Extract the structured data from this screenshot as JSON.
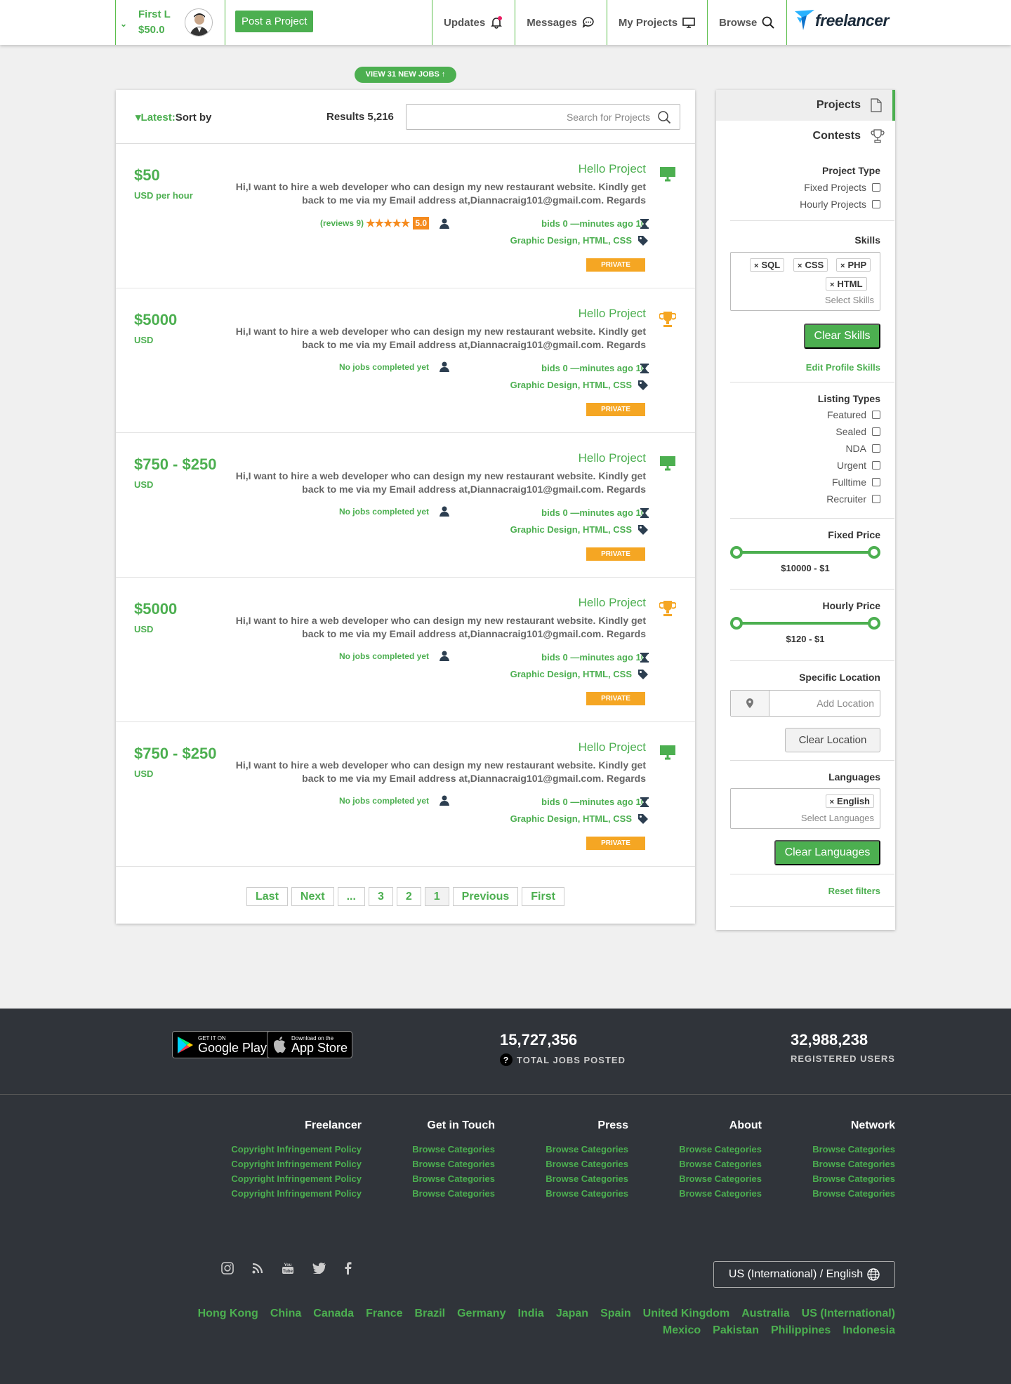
{
  "header": {
    "user_name": "First L",
    "balance": "$50.0",
    "post_button": "Post a Project",
    "nav": [
      {
        "label": "Updates",
        "icon": "bell-icon"
      },
      {
        "label": "Messages",
        "icon": "chat-icon"
      },
      {
        "label": "My Projects",
        "icon": "monitor-icon"
      },
      {
        "label": "Browse",
        "icon": "search-icon"
      }
    ],
    "logo_text": "freelancer"
  },
  "new_jobs_banner": "VIEW 31 NEW JOBS ↑",
  "toolbar": {
    "sort_value": "Latest:",
    "sort_label": "Sort by",
    "results": "Results 5,216",
    "search_placeholder": "Search for Projects"
  },
  "projects": [
    {
      "price": "$50",
      "unit": "USD per hour",
      "title": "Hello Project",
      "type_icon": "monitor-icon",
      "description": "Hi,I want to hire a web developer who can design my new restaurant website. Kindly get back to me via my Email address at,Diannacraig101@gmail.com. Regards",
      "reviews": "(reviews 9)",
      "stars": "★★★★★",
      "score": "5.0",
      "jobs_completed": "",
      "bids": "bids 0 —minutes ago 10",
      "tags": "Graphic Design, HTML, CSS",
      "badge": "PRIVATE"
    },
    {
      "price": "$5000",
      "unit": "USD",
      "title": "Hello Project",
      "type_icon": "trophy-icon",
      "description": "Hi,I want to hire a web developer who can design my new restaurant website. Kindly get back to me via my Email address at,Diannacraig101@gmail.com. Regards",
      "jobs_completed": "No jobs completed yet",
      "bids": "bids 0 —minutes ago 10",
      "tags": "Graphic Design, HTML, CSS",
      "badge": "PRIVATE"
    },
    {
      "price": "$750 - $250",
      "unit": "USD",
      "title": "Hello Project",
      "type_icon": "monitor-icon",
      "description": "Hi,I want to hire a web developer who can design my new restaurant website. Kindly get back to me via my Email address at,Diannacraig101@gmail.com. Regards",
      "jobs_completed": "No jobs completed yet",
      "bids": "bids 0 —minutes ago 10",
      "tags": "Graphic Design, HTML, CSS",
      "badge": "PRIVATE"
    },
    {
      "price": "$5000",
      "unit": "USD",
      "title": "Hello Project",
      "type_icon": "trophy-icon",
      "description": "Hi,I want to hire a web developer who can design my new restaurant website. Kindly get back to me via my Email address at,Diannacraig101@gmail.com. Regards",
      "jobs_completed": "No jobs completed yet",
      "bids": "bids 0 —minutes ago 10",
      "tags": "Graphic Design, HTML, CSS",
      "badge": "PRIVATE"
    },
    {
      "price": "$750 - $250",
      "unit": "USD",
      "title": "Hello Project",
      "type_icon": "monitor-icon",
      "description": "Hi,I want to hire a web developer who can design my new restaurant website. Kindly get back to me via my Email address at,Diannacraig101@gmail.com. Regards",
      "jobs_completed": "No jobs completed yet",
      "bids": "bids 0 —minutes ago 10",
      "tags": "Graphic Design, HTML, CSS",
      "badge": "PRIVATE"
    }
  ],
  "pagination": [
    "Last",
    "Next",
    "...",
    "3",
    "2",
    "1",
    "Previous",
    "First"
  ],
  "sidebar": {
    "tabs": [
      {
        "label": "Projects",
        "icon": "document-icon"
      },
      {
        "label": "Contests",
        "icon": "trophy-icon"
      }
    ],
    "project_type": {
      "title": "Project Type",
      "options": [
        "Fixed Projects",
        "Hourly Projects"
      ]
    },
    "skills": {
      "title": "Skills",
      "chips": [
        "SQL",
        "CSS",
        "PHP",
        "HTML"
      ],
      "placeholder": "Select Skills",
      "clear": "Clear Skills",
      "edit": "Edit Profile Skills"
    },
    "listing_types": {
      "title": "Listing Types",
      "options": [
        "Featured",
        "Sealed",
        "NDA",
        "Urgent",
        "Fulltime",
        "Recruiter"
      ]
    },
    "fixed_price": {
      "title": "Fixed Price",
      "range": "$10000 - $1"
    },
    "hourly_price": {
      "title": "Hourly Price",
      "range": "$120 - $1"
    },
    "location": {
      "title": "Specific Location",
      "placeholder": "Add Location",
      "clear": "Clear Location"
    },
    "languages": {
      "title": "Languages",
      "chips": [
        "English"
      ],
      "placeholder": "Select Languages",
      "clear": "Clear Languages"
    },
    "reset": "Reset filters"
  },
  "footer": {
    "google_play": {
      "small": "GET IT ON",
      "big": "Google Play"
    },
    "app_store": {
      "small": "Download on the",
      "big": "App Store"
    },
    "jobs_posted": {
      "number": "15,727,356",
      "label": "TOTAL JOBS POSTED"
    },
    "registered_users": {
      "number": "32,988,238",
      "label": "REGISTERED USERS"
    },
    "columns": [
      {
        "title": "Freelancer",
        "links": [
          "Copyright Infringement Policy",
          "Copyright Infringement Policy",
          "Copyright Infringement Policy",
          "Copyright Infringement Policy"
        ]
      },
      {
        "title": "Get in Touch",
        "links": [
          "Browse Categories",
          "Browse Categories",
          "Browse Categories",
          "Browse Categories"
        ]
      },
      {
        "title": "Press",
        "links": [
          "Browse Categories",
          "Browse Categories",
          "Browse Categories",
          "Browse Categories"
        ]
      },
      {
        "title": "About",
        "links": [
          "Browse Categories",
          "Browse Categories",
          "Browse Categories",
          "Browse Categories"
        ]
      },
      {
        "title": "Network",
        "links": [
          "Browse Categories",
          "Browse Categories",
          "Browse Categories",
          "Browse Categories"
        ]
      }
    ],
    "social_icons": [
      "instagram-icon",
      "rss-icon",
      "youtube-icon",
      "twitter-icon",
      "facebook-icon"
    ],
    "language_selector": "US (International) / English",
    "countries_row1": [
      "Hong Kong",
      "China",
      "Canada",
      "France",
      "Brazil",
      "Germany",
      "India",
      "Japan",
      "Spain",
      "United Kingdom",
      "Australia",
      "US (International)"
    ],
    "countries_row2": [
      "Mexico",
      "Pakistan",
      "Philippines",
      "Indonesia"
    ]
  },
  "colors": {
    "accent": "#4caf50",
    "badge": "#f5a623",
    "footer_bg": "#30343a"
  }
}
